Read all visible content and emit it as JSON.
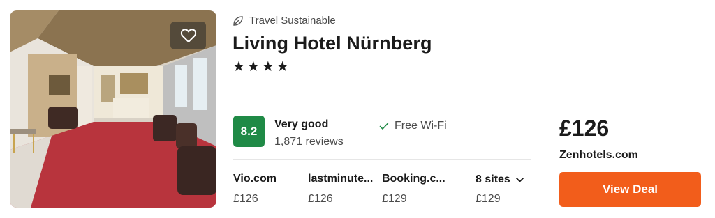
{
  "hotel": {
    "sustainability_label": "Travel Sustainable",
    "name": "Living Hotel Nürnberg",
    "stars": "★★★★",
    "star_count": 4,
    "image_icon": "hotel-photo",
    "favorite_icon": "heart-outline-icon"
  },
  "rating": {
    "score": "8.2",
    "label": "Very good",
    "reviews": "1,871 reviews",
    "color": "#1f8a46"
  },
  "amenity": {
    "check_icon": "✓",
    "label": "Free Wi-Fi"
  },
  "sites": [
    {
      "name": "Vio.com",
      "price": "£126"
    },
    {
      "name": "lastminute...",
      "price": "£126"
    },
    {
      "name": "Booking.c...",
      "price": "£129"
    }
  ],
  "more_sites": {
    "label": "8 sites",
    "price": "£129"
  },
  "deal": {
    "price": "£126",
    "provider": "Zenhotels.com",
    "button_label": "View Deal",
    "button_color": "#f25d1b"
  }
}
